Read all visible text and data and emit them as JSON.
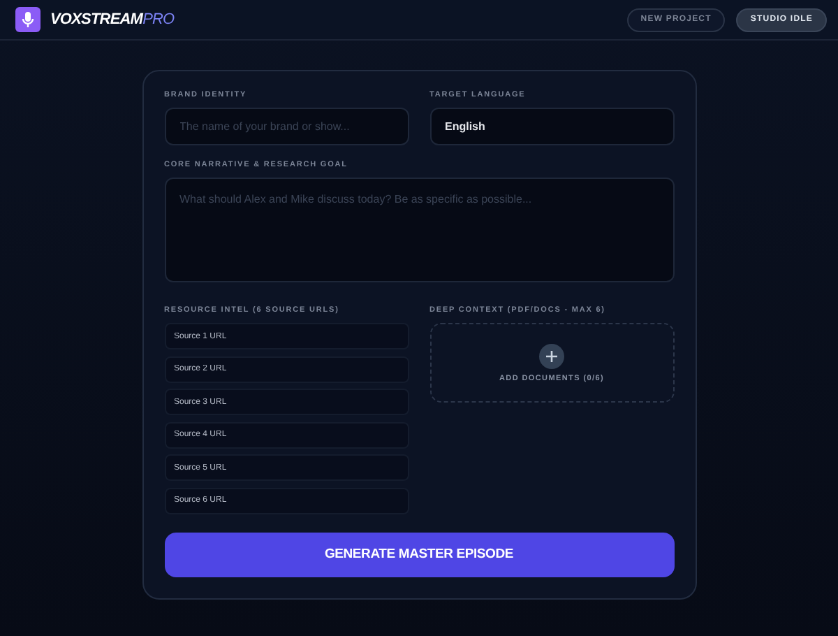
{
  "header": {
    "brand": "VOXSTREAM",
    "brand_suffix": "PRO",
    "buttons": [
      {
        "label": "NEW PROJECT",
        "kind": "outline"
      },
      {
        "label": "STUDIO IDLE",
        "kind": "status"
      }
    ]
  },
  "form": {
    "brand_identity": {
      "label": "BRAND IDENTITY",
      "placeholder": "The name of your brand or show..."
    },
    "target_language": {
      "label": "TARGET LANGUAGE",
      "value": "English"
    },
    "core_narrative": {
      "label": "CORE NARRATIVE & RESEARCH GOAL",
      "placeholder": "What should Alex and Mike discuss today? Be as specific as possible..."
    },
    "resource_intel": {
      "label": "RESOURCE INTEL (6 SOURCE URLS)",
      "sources": [
        {
          "placeholder": "Source 1 URL"
        },
        {
          "placeholder": "Source 2 URL"
        },
        {
          "placeholder": "Source 3 URL"
        },
        {
          "placeholder": "Source 4 URL"
        },
        {
          "placeholder": "Source 5 URL"
        },
        {
          "placeholder": "Source 6 URL"
        }
      ]
    },
    "deep_context": {
      "label": "DEEP CONTEXT (PDF/DOCS - MAX 6)",
      "add_button": "ADD DOCUMENTS (0/6)"
    },
    "generate_button": "GENERATE MASTER EPISODE"
  }
}
